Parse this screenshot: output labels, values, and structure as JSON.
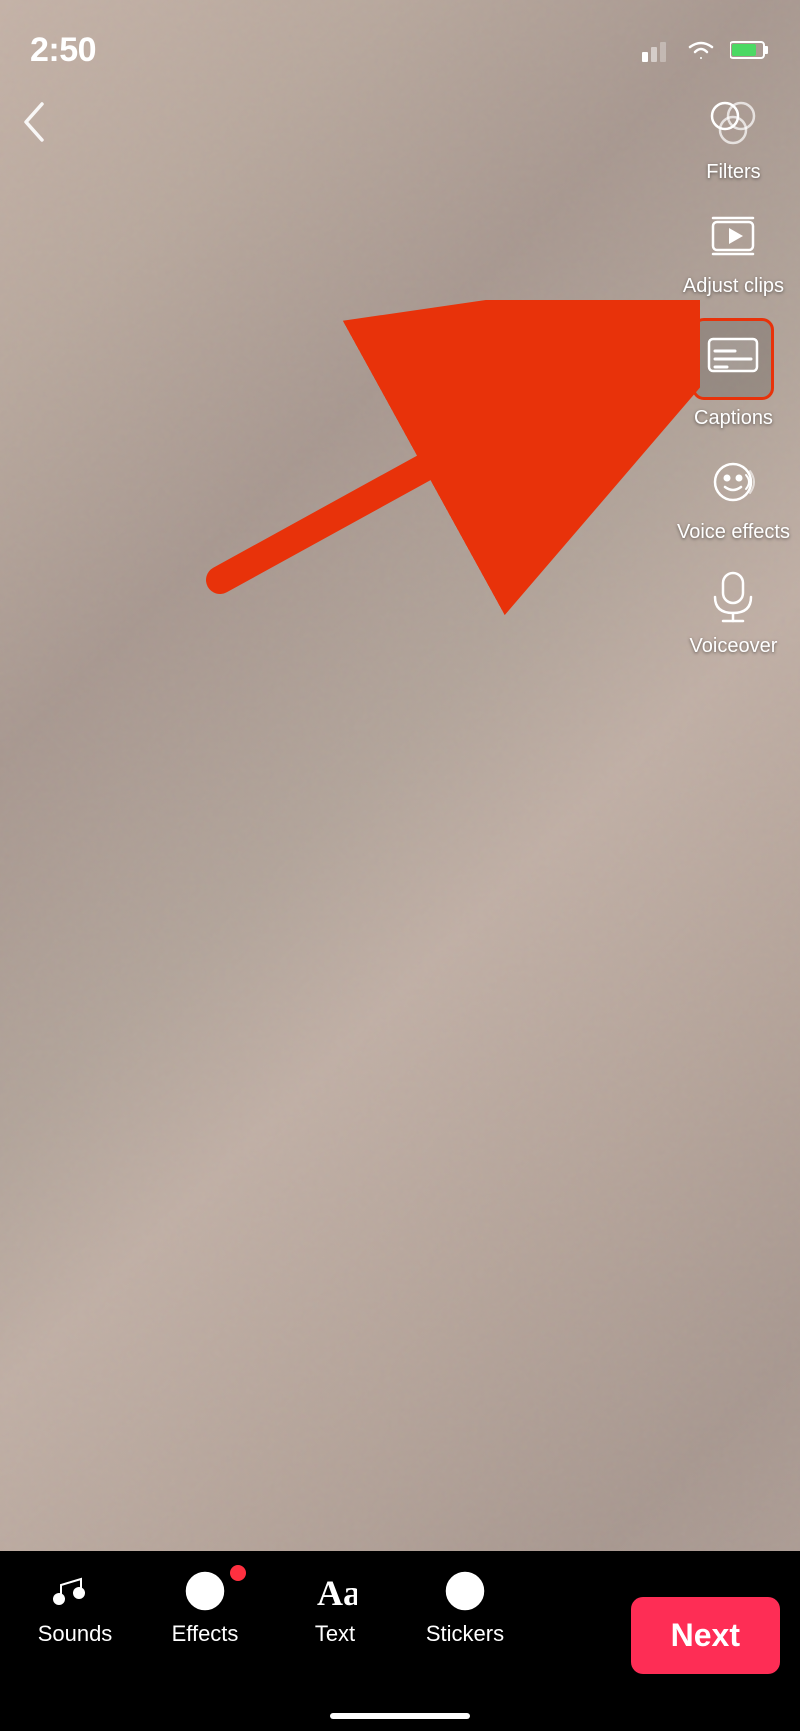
{
  "status": {
    "time": "2:50"
  },
  "toolbar": {
    "back_label": "‹",
    "filters_label": "Filters",
    "adjust_clips_label": "Adjust clips",
    "captions_label": "Captions",
    "voice_effects_label": "Voice effects",
    "voiceover_label": "Voiceover"
  },
  "bottom_nav": {
    "sounds_label": "Sounds",
    "effects_label": "Effects",
    "text_label": "Text",
    "stickers_label": "Stickers",
    "next_label": "Next"
  }
}
